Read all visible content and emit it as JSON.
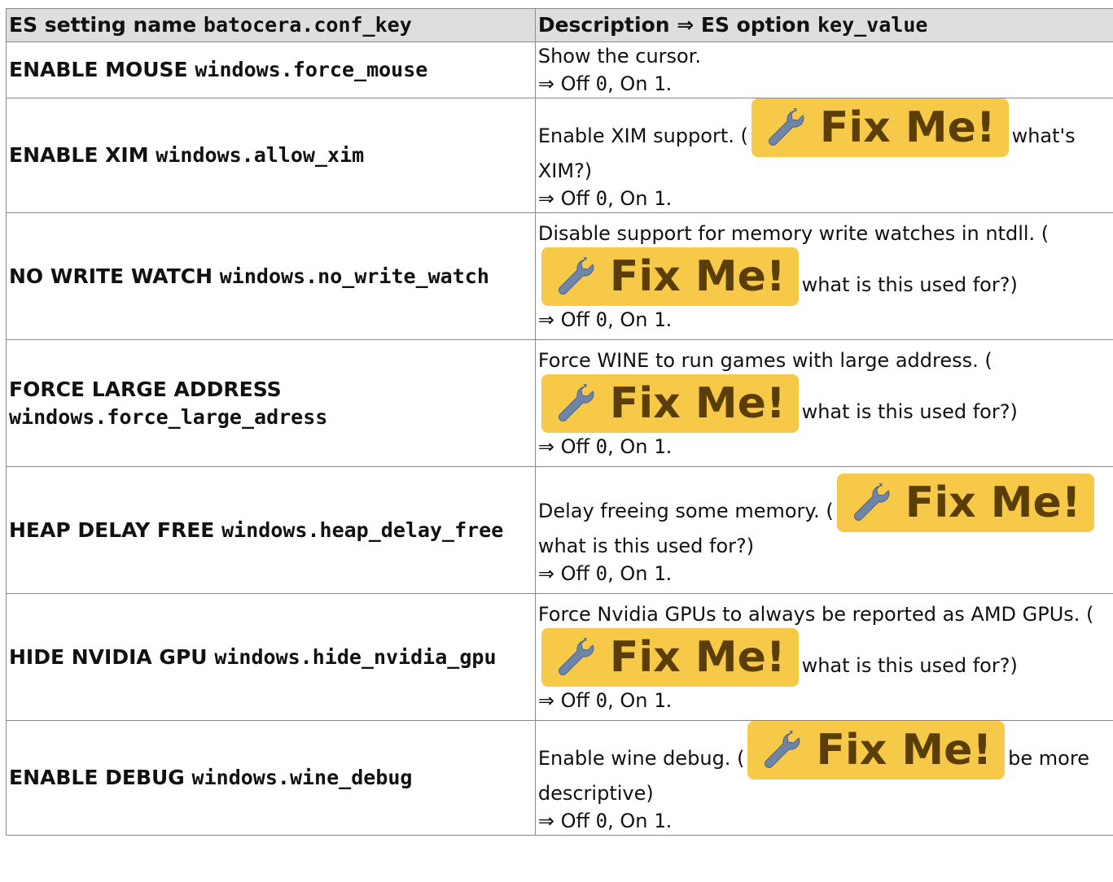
{
  "table": {
    "headers": {
      "col1_label": "ES setting name",
      "col1_key": "batocera.conf_key",
      "col2_label": "Description ⇒ ES option",
      "col2_key": "key_value"
    },
    "fixme_label": "Fix Me!",
    "rows": [
      {
        "name": "ENABLE MOUSE",
        "key": "windows.force_mouse",
        "desc_before": "Show the cursor.",
        "fixme_note": "",
        "desc_after": "",
        "opt1_label": "Off",
        "opt1_value": "0",
        "opt2_label": "On",
        "opt2_value": "1"
      },
      {
        "name": "ENABLE XIM",
        "key": "windows.allow_xim",
        "desc_before": "Enable XIM support. (",
        "fixme_note": "what's XIM?)",
        "desc_after": "",
        "opt1_label": "Off",
        "opt1_value": "0",
        "opt2_label": "On",
        "opt2_value": "1"
      },
      {
        "name": "NO WRITE WATCH",
        "key": "windows.no_write_watch",
        "desc_before": "Disable support for memory write watches in ntdll. (",
        "fixme_note": "what is this used for?)",
        "desc_after": "",
        "opt1_label": "Off",
        "opt1_value": "0",
        "opt2_label": "On",
        "opt2_value": "1"
      },
      {
        "name": "FORCE LARGE ADDRESS",
        "key": "windows.force_large_adress",
        "desc_before": "Force WINE to run games with large address. (",
        "fixme_note": "what is this used for?)",
        "desc_after": "",
        "opt1_label": "Off",
        "opt1_value": "0",
        "opt2_label": "On",
        "opt2_value": "1"
      },
      {
        "name": "HEAP DELAY FREE",
        "key": "windows.heap_delay_free",
        "desc_before": "Delay freeing some memory. (",
        "fixme_note": "what is this used for?)",
        "desc_after": "",
        "opt1_label": "Off",
        "opt1_value": "0",
        "opt2_label": "On",
        "opt2_value": "1"
      },
      {
        "name": "HIDE NVIDIA GPU",
        "key": "windows.hide_nvidia_gpu",
        "desc_before": "Force Nvidia GPUs to always be reported as AMD GPUs. (",
        "fixme_note": "what is this used for?)",
        "desc_after": "",
        "opt1_label": "Off",
        "opt1_value": "0",
        "opt2_label": "On",
        "opt2_value": "1"
      },
      {
        "name": "ENABLE DEBUG",
        "key": "windows.wine_debug",
        "desc_before": "Enable wine debug. (",
        "fixme_note": "be more descriptive)",
        "desc_after": "",
        "opt1_label": "Off",
        "opt1_value": "0",
        "opt2_label": "On",
        "opt2_value": "1"
      }
    ]
  },
  "colors": {
    "header_bg": "#dedede",
    "border": "#8a8a8a",
    "fixme_bg": "#f7c948",
    "fixme_text": "#5a3e06",
    "wrench_icon": "#6f85a8"
  },
  "icons": {
    "fixme": "wrench-icon"
  }
}
